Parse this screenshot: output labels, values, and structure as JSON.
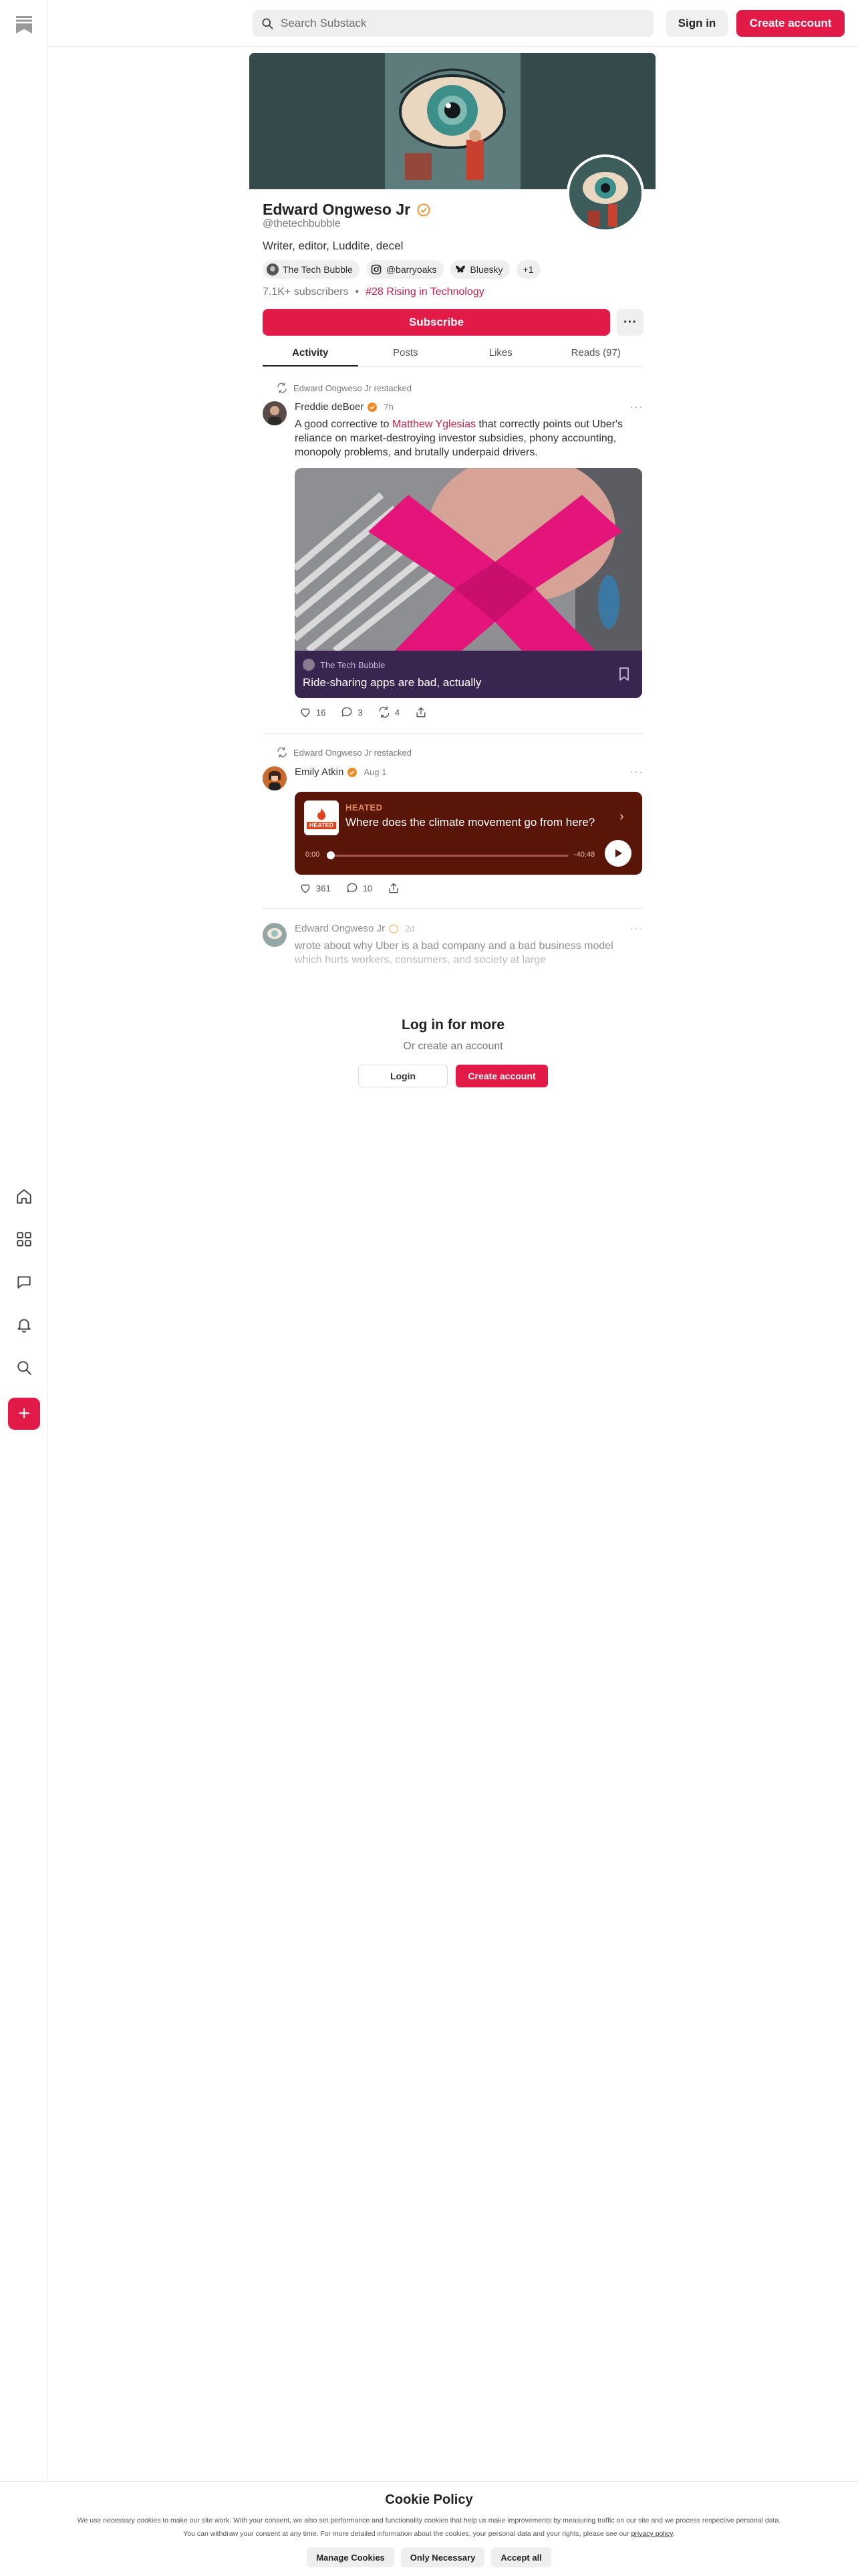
{
  "search": {
    "placeholder": "Search Substack"
  },
  "header": {
    "sign_in": "Sign in",
    "create_account": "Create account"
  },
  "rail": {
    "icons": [
      "substack-logo-icon",
      "home-icon",
      "grid-icon",
      "chat-icon",
      "bell-icon",
      "search-icon",
      "plus-icon"
    ],
    "compose_label": "+"
  },
  "profile": {
    "name": "Edward Ongweso Jr",
    "handle": "@thetechbubble",
    "bio": "Writer, editor, Luddite, decel",
    "links": [
      {
        "label": "The Tech Bubble",
        "icon": "publication-avatar-icon"
      },
      {
        "label": "@barryoaks",
        "icon": "instagram-icon"
      },
      {
        "label": "Bluesky",
        "icon": "bluesky-icon"
      }
    ],
    "links_more": "+1",
    "subscribers": "7.1K+ subscribers",
    "separator": "•",
    "rank": "#28 Rising in Technology",
    "subscribe_label": "Subscribe",
    "more_label": "···"
  },
  "tabs": [
    "Activity",
    "Posts",
    "Likes",
    "Reads (97)"
  ],
  "feed": [
    {
      "restack_label": "Edward Ongweso Jr restacked",
      "author": "Freddie deBoer",
      "time": "7h",
      "text_before": "A good corrective to ",
      "text_link": "Matthew Yglesias",
      "text_after": " that correctly points out Uber's reliance on market-destroying investor subsidies, phony accounting, monopoly problems, and brutally underpaid drivers.",
      "embed": {
        "publication": "The Tech Bubble",
        "title": "Ride-sharing apps are bad, actually"
      },
      "likes": "16",
      "comments": "3",
      "restacks": "4"
    },
    {
      "restack_label": "Edward Ongweso Jr restacked",
      "author": "Emily Atkin",
      "time": "Aug 1",
      "audio": {
        "publication": "HEATED",
        "logo_text": "HEATED",
        "title": "Where does the climate movement go from here?",
        "elapsed": "0:00",
        "remaining": "-40:48"
      },
      "likes": "361",
      "comments": "10"
    },
    {
      "author": "Edward Ongweso Jr",
      "time": "2d",
      "text": "wrote about why Uber is a bad company and a bad business model which hurts workers, consumers, and society at large"
    }
  ],
  "login_prompt": {
    "title": "Log in for more",
    "subtitle": "Or create an account",
    "login": "Login",
    "create": "Create account"
  },
  "cookie": {
    "title": "Cookie Policy",
    "line1": "We use necessary cookies to make our site work. With your consent, we also set performance and functionality cookies that help us make improvements by measuring traffic on our site and we process respective personal data.",
    "line2": "You can withdraw your consent at any time. For more detailed information about the cookies, your personal data and your rights, please see our ",
    "policy_link": "privacy policy",
    "line2_end": ".",
    "buttons": [
      "Manage Cookies",
      "Only Necessary",
      "Accept all"
    ]
  },
  "colors": {
    "accent": "#e21a48",
    "link": "#c3224b",
    "embed_bg": "#3a2550",
    "audio_bg": "#5a1509",
    "verified": "#f08a24"
  }
}
